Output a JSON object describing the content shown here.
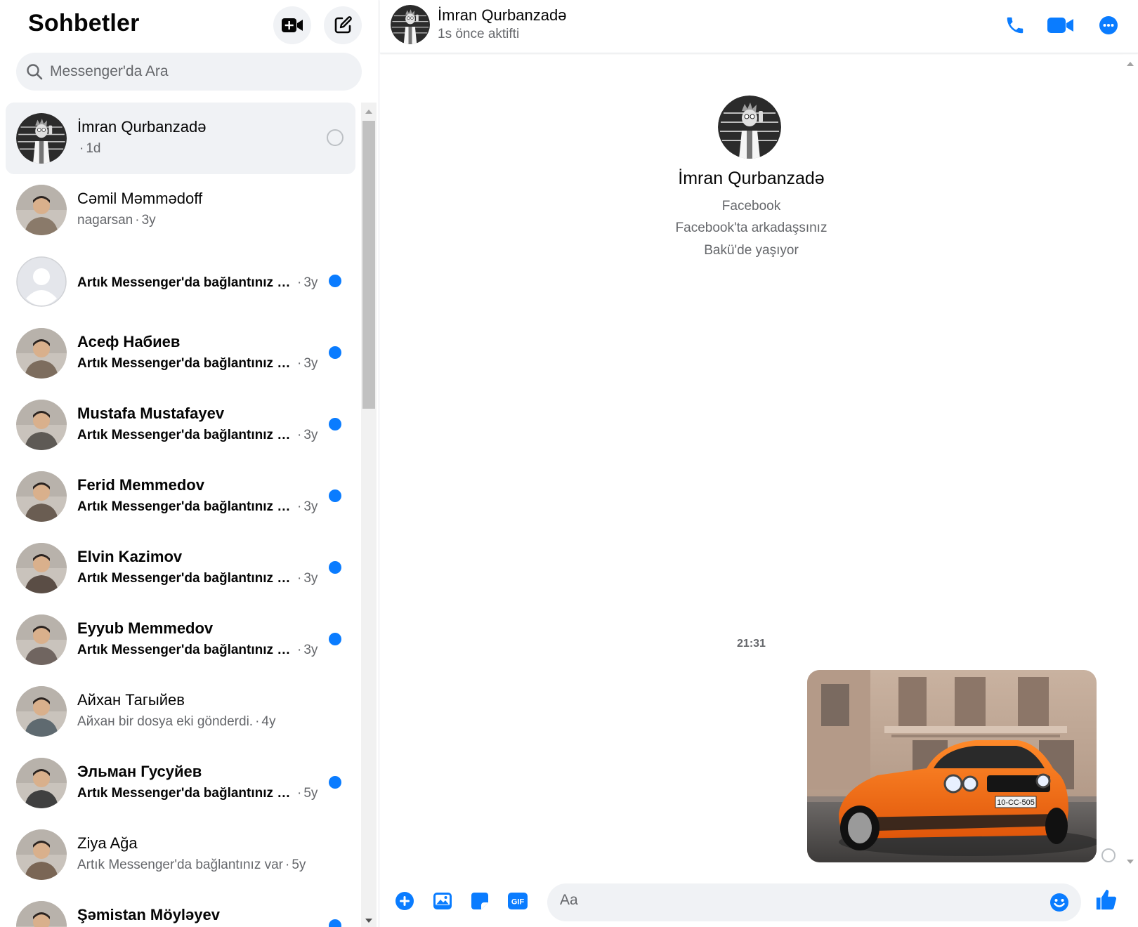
{
  "sidebar": {
    "title": "Sohbetler",
    "search_placeholder": "Messenger'da Ara",
    "conversations": [
      {
        "name": "İmran Qurbanzadə",
        "preview": "",
        "time": "1d",
        "bold": false,
        "unread": false,
        "active": true,
        "avatar": "cartoon-avatar"
      },
      {
        "name": "Cəmil Məmmədoff",
        "preview": "nagarsan",
        "time": "3y",
        "bold": false,
        "unread": false,
        "active": false,
        "avatar": "photo-avatar"
      },
      {
        "name": "",
        "preview": "Artık Messenger'da bağlantınız var",
        "time": "3y",
        "bold": true,
        "unread": true,
        "active": false,
        "avatar": "default-avatar"
      },
      {
        "name": "Асеф Набиев",
        "preview": "Artık Messenger'da bağlantınız var",
        "time": "3y",
        "bold": true,
        "unread": true,
        "active": false,
        "avatar": "photo-avatar"
      },
      {
        "name": "Mustafa Mustafayev",
        "preview": "Artık Messenger'da bağlantınız var",
        "time": "3y",
        "bold": true,
        "unread": true,
        "active": false,
        "avatar": "photo-avatar"
      },
      {
        "name": "Ferid Memmedov",
        "preview": "Artık Messenger'da bağlantınız var",
        "time": "3y",
        "bold": true,
        "unread": true,
        "active": false,
        "avatar": "photo-avatar"
      },
      {
        "name": "Elvin Kazimov",
        "preview": "Artık Messenger'da bağlantınız var",
        "time": "3y",
        "bold": true,
        "unread": true,
        "active": false,
        "avatar": "photo-avatar"
      },
      {
        "name": "Eyyub Memmedov",
        "preview": "Artık Messenger'da bağlantınız var",
        "time": "3y",
        "bold": true,
        "unread": true,
        "active": false,
        "avatar": "photo-avatar"
      },
      {
        "name": "Айхан Тагыйев",
        "preview": "Айхан bir dosya eki gönderdi.",
        "time": "4y",
        "bold": false,
        "unread": false,
        "active": false,
        "avatar": "photo-avatar"
      },
      {
        "name": "Эльман Гусуйев",
        "preview": "Artık Messenger'da bağlantınız var",
        "time": "5y",
        "bold": true,
        "unread": true,
        "active": false,
        "avatar": "photo-avatar"
      },
      {
        "name": "Ziya Ağa",
        "preview": "Artık Messenger'da bağlantınız var",
        "time": "5y",
        "bold": false,
        "unread": false,
        "active": false,
        "avatar": "photo-avatar"
      },
      {
        "name": "Şəmistan Möyləyev",
        "preview": "",
        "time": "",
        "bold": true,
        "unread": true,
        "active": false,
        "avatar": "photo-avatar"
      }
    ]
  },
  "header": {
    "name": "İmran Qurbanzadə",
    "status": "1s önce aktifti"
  },
  "profile": {
    "name": "İmran Qurbanzadə",
    "source": "Facebook",
    "friend_status": "Facebook'ta arkadaşsınız",
    "location": "Bakü'de yaşıyor"
  },
  "messages": {
    "timestamp": "21:31",
    "photo_plate": "10-CC-505"
  },
  "composer": {
    "placeholder": "Aa",
    "gif_label": "GIF"
  },
  "icons": {
    "new_room": "video-plus-icon",
    "compose": "compose-icon",
    "search": "search-icon",
    "call": "phone-icon",
    "video": "video-camera-icon",
    "more": "more-icon",
    "plus": "plus-circle-icon",
    "photo": "image-icon",
    "sticker": "sticker-icon",
    "gif": "gif-icon",
    "emoji": "emoji-icon",
    "like": "thumbs-up-icon"
  },
  "colors": {
    "accent": "#0a7cff",
    "secondary_text": "#65676b",
    "panel_bg": "#f0f2f5"
  }
}
